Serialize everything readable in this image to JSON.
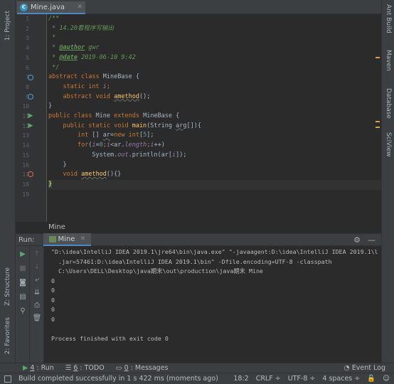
{
  "left_strip": {
    "project_tab": "1: Project",
    "structure_tab": "Z: Structure",
    "favorites_tab": "2: Favorites"
  },
  "right_strip": {
    "ant_build": "Ant Build",
    "maven": "Maven",
    "database": "Database",
    "sciview": "SciView"
  },
  "editor_tab": {
    "filename": "Mine.java"
  },
  "editor": {
    "line_numbers": [
      "1",
      "2",
      "3",
      "4",
      "5",
      "6",
      "7",
      "8",
      "9",
      "10",
      "11",
      "12",
      "13",
      "14",
      "15",
      "16",
      "17",
      "18",
      "19"
    ],
    "lines": {
      "l1": "/**",
      "l2": " * 14.20看程序写输出",
      "l3": " *",
      "l4a": " * ",
      "l4b": "@author",
      "l4c": " gwr",
      "l5a": " * ",
      "l5b": "@date",
      "l5c": " 2019-06-10 9:42",
      "l6": " */",
      "l7a": "abstract class",
      "l7b": " MineBase {",
      "l8a": "    static int ",
      "l8b": "i",
      "l8c": ";",
      "l9a": "    abstract void ",
      "l9b": "amethod",
      "l9c": "();",
      "l10": "}",
      "l11a": "public class",
      "l11b": " Mine ",
      "l11c": "extends",
      "l11d": " MineBase {",
      "l12a": "    public static void ",
      "l12b": "main",
      "l12c": "(String ",
      "l12d": "arg",
      "l12e": "[]){",
      "l13a": "        ",
      "l13b": "int",
      "l13c": " [] ",
      "l13d": "ar",
      "l13e": "=",
      "l13f": "new int",
      "l13g": "[",
      "l13h": "5",
      "l13i": "];",
      "l14a": "        ",
      "l14b": "for",
      "l14c": "(",
      "l14d": "i",
      "l14e": "=",
      "l14f": "0",
      "l14g": ";",
      "l14h": "i",
      "l14i": "<ar.",
      "l14j": "length",
      "l14k": ";",
      "l14l": "i",
      "l14m": "++)",
      "l15a": "            System.",
      "l15b": "out",
      "l15c": ".println(ar[",
      "l15d": "i",
      "l15e": "]);",
      "l16": "    }",
      "l17a": "    ",
      "l17b": "void",
      "l17c": " ",
      "l17d": "amethod",
      "l17e": "(){}",
      "l18": "}",
      "l19": ""
    },
    "breadcrumb": "Mine"
  },
  "run_panel": {
    "label": "Run:",
    "tab_name": "Mine",
    "console_lines": [
      "\"D:\\idea\\IntelliJ IDEA 2019.1\\jre64\\bin\\java.exe\" \"-javaagent:D:\\idea\\IntelliJ IDEA 2019.1\\lib\\idea_rt",
      "  .jar=57461:D:\\idea\\IntelliJ IDEA 2019.1\\bin\" -Dfile.encoding=UTF-8 -classpath",
      "  C:\\Users\\DELL\\Desktop\\java期末\\out\\production\\java期末 Mine",
      "0",
      "0",
      "0",
      "0",
      "0",
      "",
      "Process finished with exit code 0"
    ]
  },
  "bottom_tabs": {
    "run_num": "4",
    "run": ": Run",
    "todo_num": "6",
    "todo": ": TODO",
    "messages_num": "0",
    "messages": ": Messages",
    "event_log": "Event Log"
  },
  "status_bar": {
    "message": "Build completed successfully in 1 s 422 ms (moments ago)",
    "position": "18:2",
    "line_sep": "CRLF ÷",
    "encoding": "UTF-8 ÷",
    "indent": "4 spaces ÷"
  },
  "colors": {
    "background": "#2b2b2b",
    "panel": "#3c3f41",
    "keyword": "#cc7832",
    "comment": "#629755",
    "number": "#6897bb",
    "field": "#9876aa",
    "method": "#ffc66d",
    "accent": "#4a88c7"
  }
}
